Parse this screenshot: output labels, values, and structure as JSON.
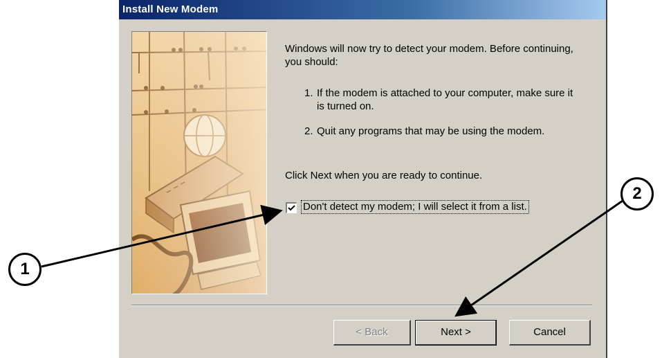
{
  "window": {
    "title": "Install New Modem"
  },
  "content": {
    "intro": "Windows will now try to detect your modem.  Before continuing, you should:",
    "steps": [
      {
        "number": "1.",
        "text": "If the modem is attached to your computer, make sure it is turned on."
      },
      {
        "number": "2.",
        "text": "Quit any programs that may be using the modem."
      }
    ],
    "ready_text": "Click Next when you are ready to continue.",
    "checkbox": {
      "label": "Don't detect my modem; I will select it from a list.",
      "checked": true
    }
  },
  "buttons": {
    "back_label": "< Back",
    "next_label": "Next >",
    "cancel_label": "Cancel"
  },
  "callouts": [
    {
      "label": "1"
    },
    {
      "label": "2"
    }
  ],
  "colors": {
    "titlebar": "#0a246a",
    "dialog_bg": "#d4d0c8",
    "wizard_image_tone": "#e0b070"
  }
}
